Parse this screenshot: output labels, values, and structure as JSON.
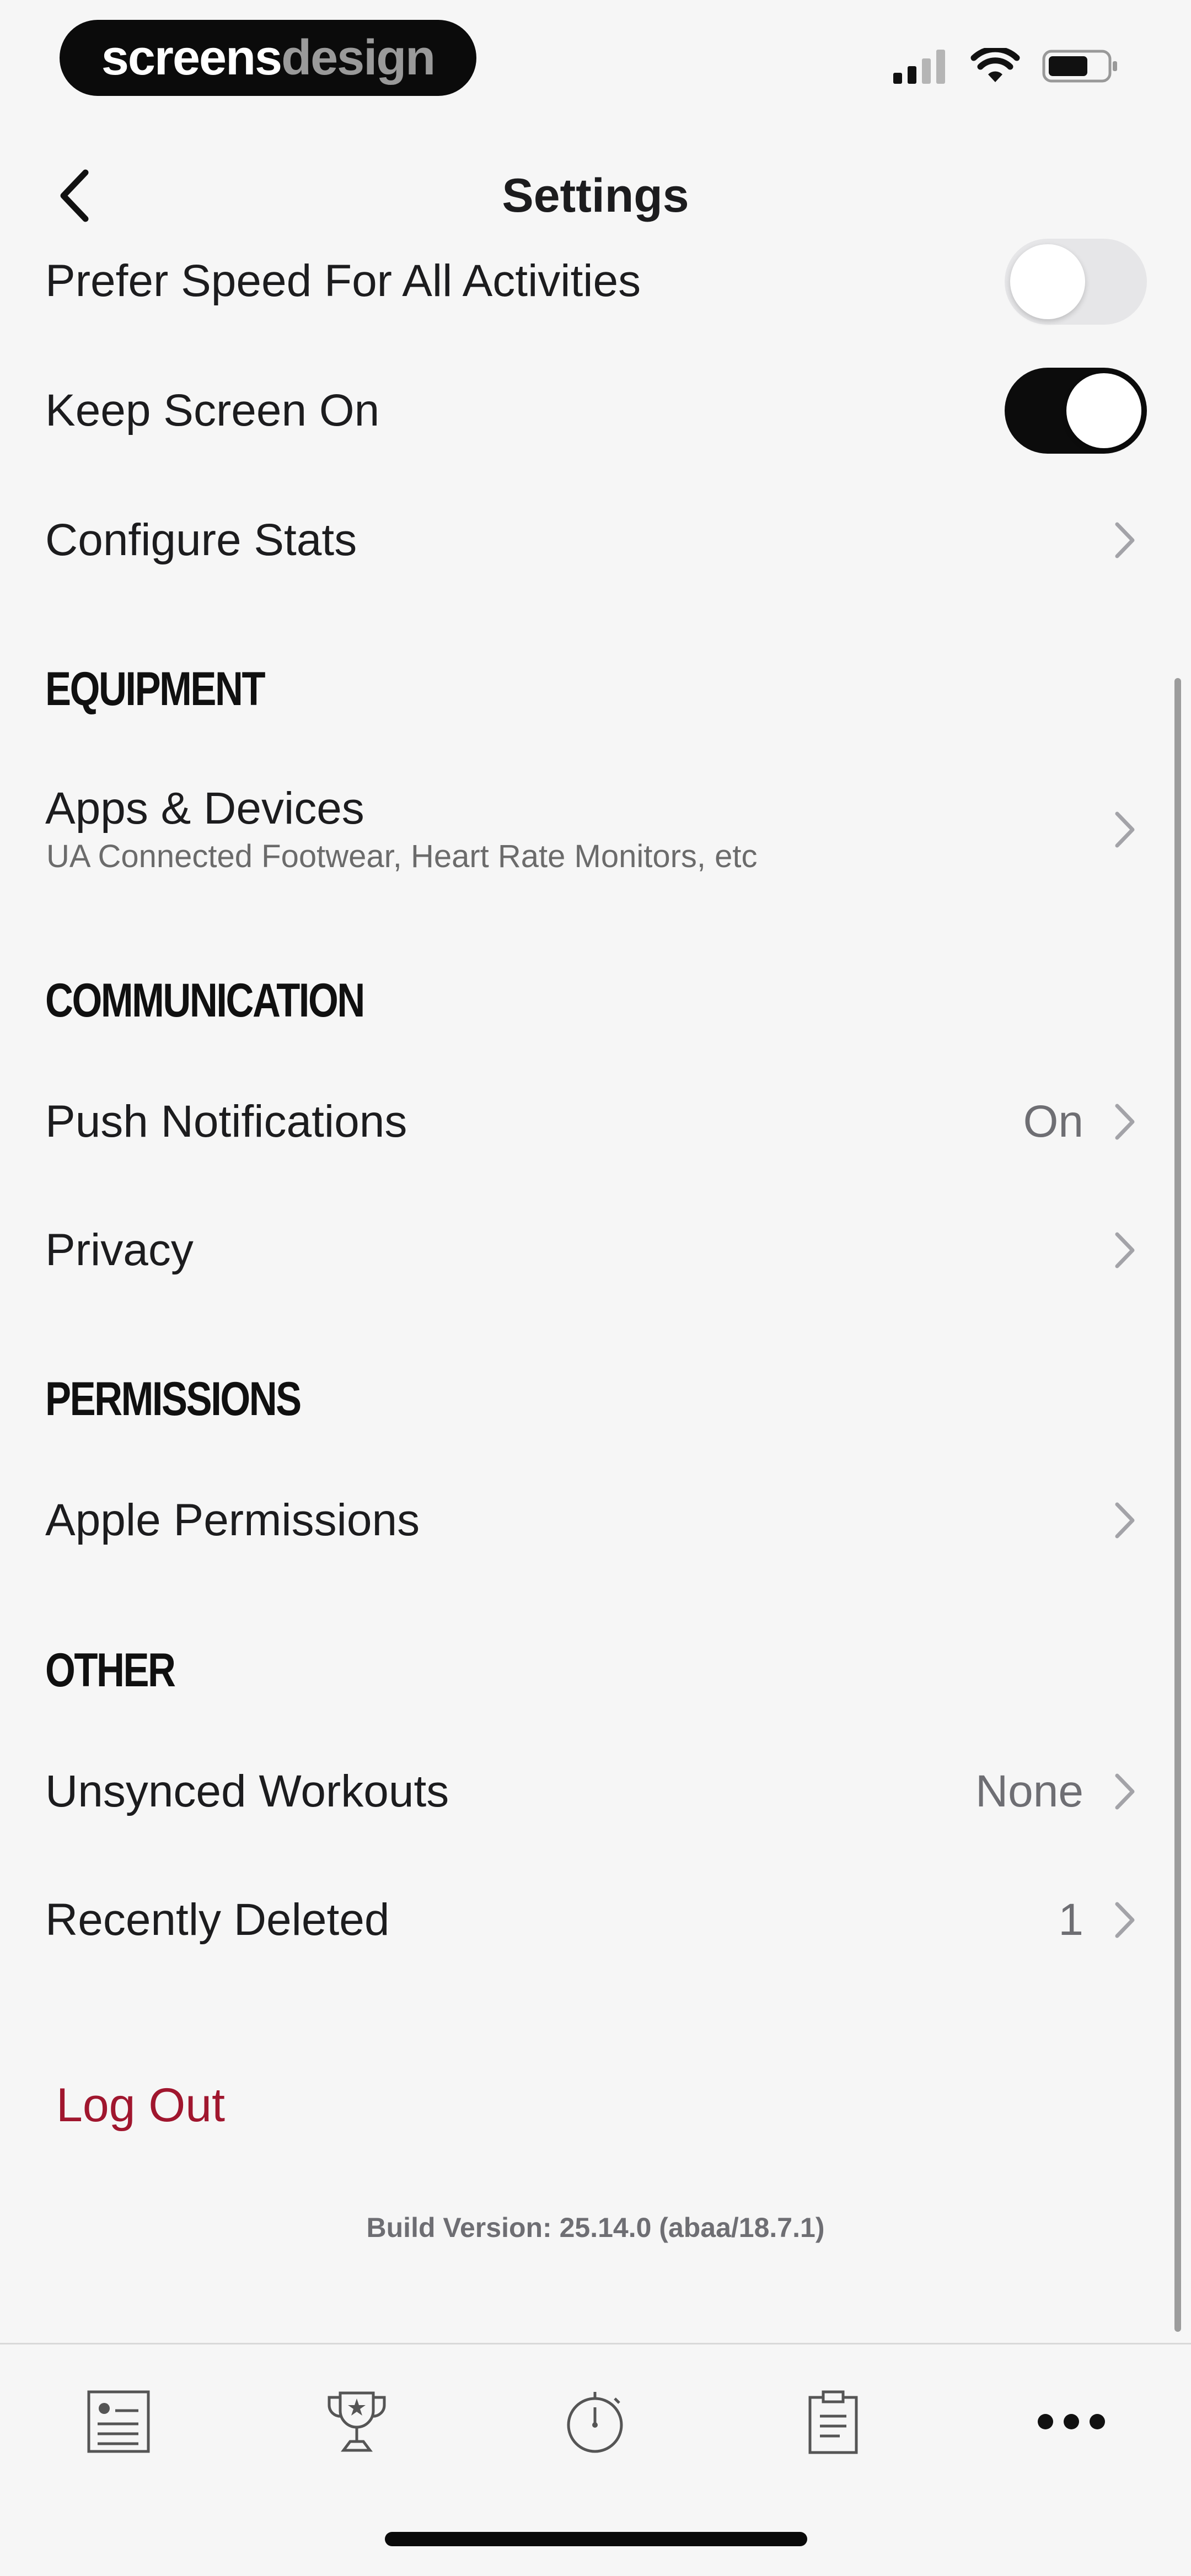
{
  "status_bar": {
    "brand_primary": "screens",
    "brand_secondary": "design"
  },
  "nav": {
    "title": "Settings"
  },
  "rows": {
    "prefer_speed": {
      "label": "Prefer Speed For All Activities",
      "toggle_on": false
    },
    "keep_screen_on": {
      "label": "Keep Screen On",
      "toggle_on": true
    },
    "configure_stats": {
      "label": "Configure Stats"
    },
    "apps_devices": {
      "label": "Apps & Devices",
      "subtitle": "UA Connected Footwear, Heart Rate Monitors, etc"
    },
    "push_notifications": {
      "label": "Push Notifications",
      "value": "On"
    },
    "privacy": {
      "label": "Privacy"
    },
    "apple_permissions": {
      "label": "Apple Permissions"
    },
    "unsynced_workouts": {
      "label": "Unsynced Workouts",
      "value": "None"
    },
    "recently_deleted": {
      "label": "Recently Deleted",
      "value": "1"
    }
  },
  "sections": {
    "equipment": "EQUIPMENT",
    "communication": "COMMUNICATION",
    "permissions": "PERMISSIONS",
    "other": "OTHER"
  },
  "logout_label": "Log Out",
  "build_version": "Build Version: 25.14.0 (abaa/18.7.1)",
  "tab_bar": {
    "icons": [
      "feed-icon",
      "trophy-icon",
      "stopwatch-icon",
      "clipboard-icon",
      "more-icon"
    ]
  },
  "colors": {
    "accent_red": "#a0162e",
    "toggle_on": "#0c0c0c",
    "toggle_off": "#e6e6e8",
    "background": "#f6f6f6"
  }
}
